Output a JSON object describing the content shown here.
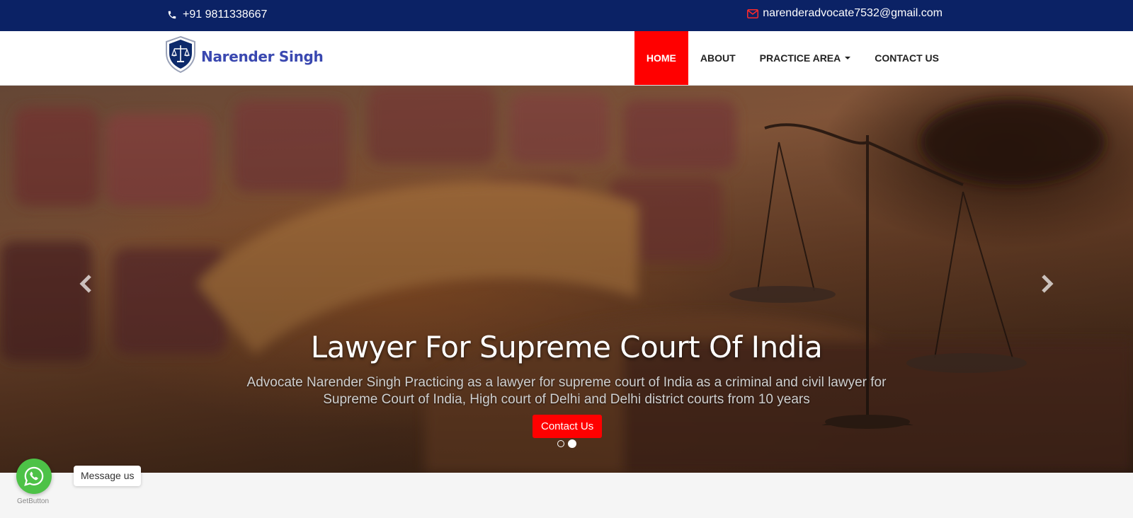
{
  "topbar": {
    "phone": "+91 9811338667",
    "email": "narenderadvocate7532@gmail.com",
    "phone_icon": "phone-icon",
    "email_icon": "envelope-icon"
  },
  "header": {
    "logo_text": "Narender Singh",
    "logo_icon": "shield-scales-icon",
    "nav": [
      {
        "label": "HOME",
        "active": true
      },
      {
        "label": "ABOUT",
        "active": false
      },
      {
        "label": "PRACTICE AREA",
        "active": false,
        "dropdown": true
      },
      {
        "label": "CONTACT US",
        "active": false
      }
    ]
  },
  "hero": {
    "title": "Lawyer For Supreme Court Of India",
    "description": "Advocate Narender Singh Practicing as a lawyer for supreme court of India as a criminal and civil lawyer for Supreme Court of India, High court of Delhi and Delhi district courts from 10 years",
    "button_label": "Contact Us",
    "slides_total": 2,
    "active_slide": 2,
    "prev_icon": "chevron-left-icon",
    "next_icon": "chevron-right-icon"
  },
  "widget": {
    "label": "Message us",
    "credit": "GetButton",
    "icon": "whatsapp-icon"
  },
  "colors": {
    "topbar": "#0b2265",
    "accent": "#ff0000",
    "logo_text": "#3a48b0",
    "whatsapp": "#4dc247"
  }
}
